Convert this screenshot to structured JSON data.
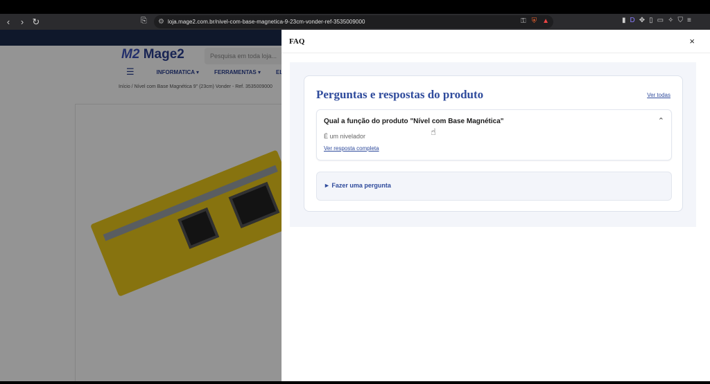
{
  "browser": {
    "url": "loja.mage2.com.br/nivel-com-base-magnetica-9-23cm-vonder-ref-3535009000",
    "back_icon": "chevron-left-icon",
    "forward_icon": "chevron-right-icon",
    "reload_icon": "reload-icon"
  },
  "site": {
    "logo_text": "Mage2",
    "search_placeholder": "Pesquisa em toda loja...",
    "menu": [
      "INFORMATICA ▾",
      "FERRAMENTAS ▾",
      "ELET"
    ],
    "breadcrumb": "Início  /  Nível com Base Magnética 9\" (23cm) Vonder - Ref. 3535009000"
  },
  "drawer": {
    "title": "FAQ",
    "close_symbol": "×",
    "heading": "Perguntas e respostas do produto",
    "see_all": "Ver todas",
    "question": "Qual a função do produto \"Nível com Base Magnética\"",
    "answer": "É um nivelador",
    "see_full_answer": "Ver resposta completa",
    "ask_question": "► Fazer uma pergunta"
  },
  "colors": {
    "accent": "#2f4b9c",
    "brand": "#1b2a4a"
  }
}
